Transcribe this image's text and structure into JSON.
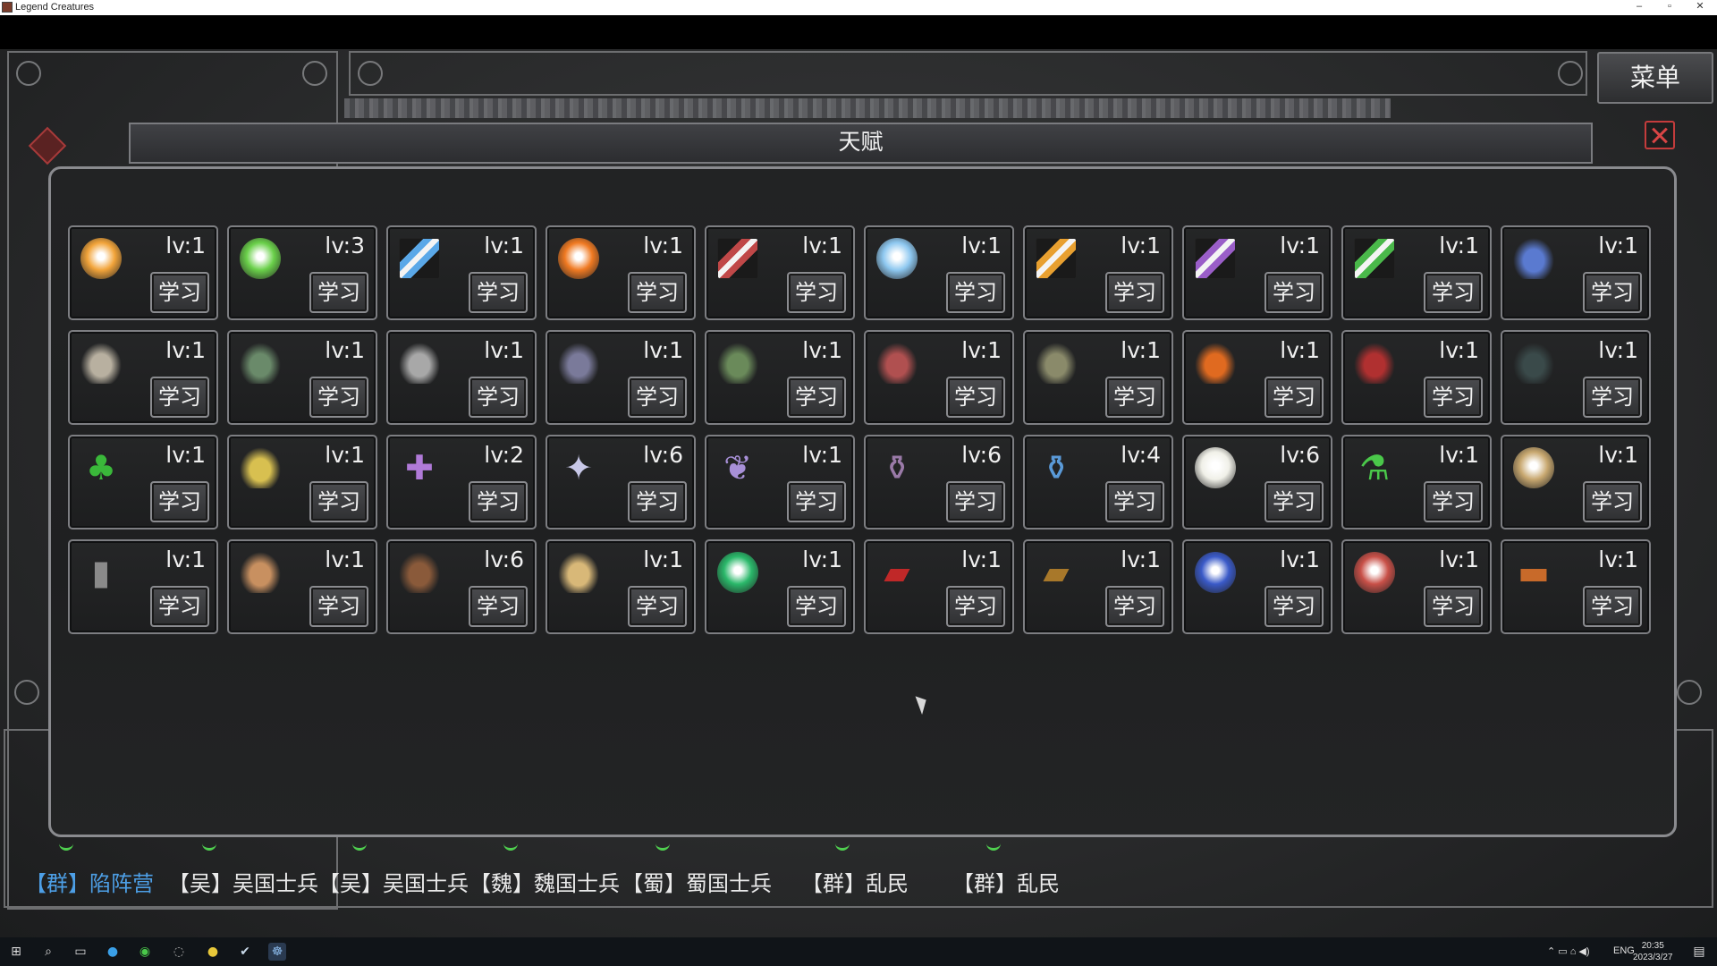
{
  "window": {
    "title": "Legend Creatures",
    "controls": [
      "–",
      "▫",
      "✕"
    ]
  },
  "menu_button": "菜单",
  "dialog": {
    "title": "天赋",
    "close_icon": "close-icon",
    "learn_label": "学习",
    "talents": [
      {
        "level": "lv:1",
        "icon": "gold-orb",
        "color": "#f2a43a"
      },
      {
        "level": "lv:3",
        "icon": "green-orb",
        "color": "#6ad04a"
      },
      {
        "level": "lv:1",
        "icon": "blue-sword",
        "color": "#5aa8e8"
      },
      {
        "level": "lv:1",
        "icon": "fire-orb",
        "color": "#f07a22"
      },
      {
        "level": "lv:1",
        "icon": "red-sword",
        "color": "#c04848"
      },
      {
        "level": "lv:1",
        "icon": "ice-orb",
        "color": "#8ec8f0"
      },
      {
        "level": "lv:1",
        "icon": "gold-sword",
        "color": "#e8a030"
      },
      {
        "level": "lv:1",
        "icon": "purple-sword",
        "color": "#9a5ec8"
      },
      {
        "level": "lv:1",
        "icon": "green-sword",
        "color": "#4ab84a"
      },
      {
        "level": "lv:1",
        "icon": "flying-creature",
        "color": "#5a7ad0"
      },
      {
        "level": "lv:1",
        "icon": "skeleton-warrior",
        "color": "#b8b0a0"
      },
      {
        "level": "lv:1",
        "icon": "hooded-figure",
        "color": "#6a8a6a"
      },
      {
        "level": "lv:1",
        "icon": "wolf",
        "color": "#a8a8a8"
      },
      {
        "level": "lv:1",
        "icon": "armored-knight",
        "color": "#7a7a9a"
      },
      {
        "level": "lv:1",
        "icon": "zombie",
        "color": "#6a8a5a"
      },
      {
        "level": "lv:1",
        "icon": "plant-creature",
        "color": "#b05050"
      },
      {
        "level": "lv:1",
        "icon": "rock-beast",
        "color": "#8a8a6a"
      },
      {
        "level": "lv:1",
        "icon": "fire-elemental",
        "color": "#e06a20"
      },
      {
        "level": "lv:1",
        "icon": "red-demon",
        "color": "#b03030"
      },
      {
        "level": "lv:1",
        "icon": "dark-wraith",
        "color": "#3a4a4a"
      },
      {
        "level": "lv:1",
        "icon": "clover",
        "color": "#3ab83a"
      },
      {
        "level": "lv:1",
        "icon": "golden-wheat",
        "color": "#d8c050"
      },
      {
        "level": "lv:2",
        "icon": "purple-cross",
        "color": "#b07ad8"
      },
      {
        "level": "lv:6",
        "icon": "star-shard",
        "color": "#c8c8e8"
      },
      {
        "level": "lv:1",
        "icon": "spirit-swirl",
        "color": "#a890d8"
      },
      {
        "level": "lv:6",
        "icon": "purple-vase",
        "color": "#9a7aa8"
      },
      {
        "level": "lv:4",
        "icon": "blue-vase",
        "color": "#5a9ad8"
      },
      {
        "level": "lv:6",
        "icon": "clock",
        "color": "#f0f0e8"
      },
      {
        "level": "lv:1",
        "icon": "green-potion",
        "color": "#4ac84a"
      },
      {
        "level": "lv:1",
        "icon": "dark-ring",
        "color": "#c8a870"
      },
      {
        "level": "lv:1",
        "icon": "stone-tablet",
        "color": "#8a8a8a"
      },
      {
        "level": "lv:1",
        "icon": "treasure-scene",
        "color": "#c89060"
      },
      {
        "level": "lv:6",
        "icon": "warrior-portrait",
        "color": "#8a5a3a"
      },
      {
        "level": "lv:1",
        "icon": "scroll-map",
        "color": "#d8b878"
      },
      {
        "level": "lv:1",
        "icon": "green-seal",
        "color": "#2ab86a"
      },
      {
        "level": "lv:1",
        "icon": "red-book",
        "color": "#c02828"
      },
      {
        "level": "lv:1",
        "icon": "brown-book",
        "color": "#a8782a"
      },
      {
        "level": "lv:1",
        "icon": "blue-seal",
        "color": "#3a5ac8"
      },
      {
        "level": "lv:1",
        "icon": "red-seal",
        "color": "#c85048"
      },
      {
        "level": "lv:1",
        "icon": "treasure-chest",
        "color": "#c86a2a"
      }
    ]
  },
  "unit_bar": [
    {
      "text": "【群】陷阵营",
      "color": "#4d9fe6"
    },
    {
      "text": "【吴】吴国士兵",
      "color": "#eaeaea"
    },
    {
      "text": "【吴】吴国士兵",
      "color": "#eaeaea"
    },
    {
      "text": "【魏】魏国士兵",
      "color": "#eaeaea"
    },
    {
      "text": "【蜀】蜀国士兵",
      "color": "#eaeaea"
    },
    {
      "text": "【群】乱民",
      "color": "#eaeaea"
    },
    {
      "text": "【群】乱民",
      "color": "#eaeaea"
    }
  ],
  "taskbar": {
    "tray_lang": "ENG",
    "time": "20:35",
    "date": "2023/3/27"
  }
}
